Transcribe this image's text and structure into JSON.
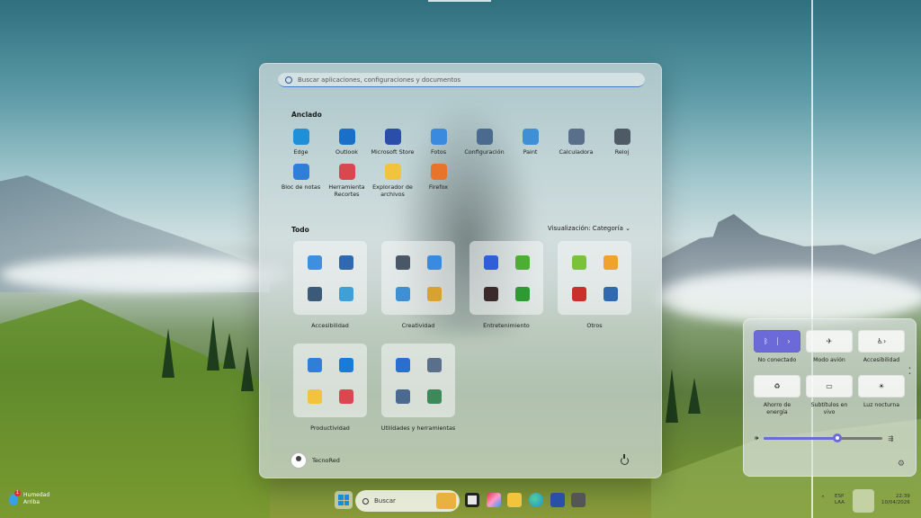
{
  "start_menu": {
    "search_placeholder": "Buscar aplicaciones, configuraciones y documentos",
    "pinned_title": "Anclado",
    "pinned": [
      {
        "label": "Edge",
        "icon": "edge-icon",
        "color": "#1f8fd8"
      },
      {
        "label": "Outlook",
        "icon": "outlook-icon",
        "color": "#1a6fc8"
      },
      {
        "label": "Microsoft Store",
        "icon": "store-icon",
        "color": "#2b4fa8"
      },
      {
        "label": "Fotos",
        "icon": "photos-icon",
        "color": "#3a8be0"
      },
      {
        "label": "Configuración",
        "icon": "gear-icon",
        "color": "#4a6a90"
      },
      {
        "label": "Paint",
        "icon": "paint-icon",
        "color": "#3f8fd5"
      },
      {
        "label": "Calculadora",
        "icon": "calculator-icon",
        "color": "#5a6f8a"
      },
      {
        "label": "Reloj",
        "icon": "clock-icon",
        "color": "#4e5a66"
      },
      {
        "label": "Bloc de notas",
        "icon": "notepad-icon",
        "color": "#2f7fd8"
      },
      {
        "label": "Herramienta Recortes",
        "icon": "snipping-tool-icon",
        "color": "#d9474f"
      },
      {
        "label": "Explorador de archivos",
        "icon": "folder-icon",
        "color": "#f2c33c"
      },
      {
        "label": "Firefox",
        "icon": "firefox-icon",
        "color": "#e8732a"
      }
    ],
    "all_title": "Todo",
    "view_label": "Visualización: Categoría",
    "categories": [
      {
        "label": "Accesibilidad",
        "icons": [
          {
            "name": "voice-access-icon",
            "color": "#3f8fe0"
          },
          {
            "name": "magnifier-icon",
            "color": "#2f6ab0"
          },
          {
            "name": "narrator-icon",
            "color": "#3a5a78"
          },
          {
            "name": "keyboard-icon",
            "color": "#3fa0d8"
          }
        ]
      },
      {
        "label": "Creatividad",
        "icons": [
          {
            "name": "camera-icon",
            "color": "#4a5766"
          },
          {
            "name": "photos-icon",
            "color": "#3a8be0"
          },
          {
            "name": "paint-icon",
            "color": "#3f8fd5"
          },
          {
            "name": "clipchamp-icon",
            "color": "#d9a22f"
          }
        ]
      },
      {
        "label": "Entretenimiento",
        "icons": [
          {
            "name": "headphones-icon",
            "color": "#2e5ed8"
          },
          {
            "name": "nvidia-icon",
            "color": "#4caf34"
          },
          {
            "name": "media-player-icon",
            "color": "#3a2a2a"
          },
          {
            "name": "xbox-icon",
            "color": "#2e9a34"
          }
        ]
      },
      {
        "label": "Otros",
        "icons": [
          {
            "name": "cube-icon",
            "color": "#7ac23a"
          },
          {
            "name": "weather-icon",
            "color": "#f0a22c"
          },
          {
            "name": "filezilla-icon",
            "color": "#c9302c"
          },
          {
            "name": "settings-cluster-icon",
            "color": "#2f6ab0"
          }
        ]
      },
      {
        "label": "Productividad",
        "icons": [
          {
            "name": "notepad-icon",
            "color": "#2f7fd8"
          },
          {
            "name": "remote-desktop-icon",
            "color": "#1a7ad8"
          },
          {
            "name": "folder-icon",
            "color": "#f2c33c"
          },
          {
            "name": "office-icon",
            "color": "#d9474f"
          }
        ]
      },
      {
        "label": "Utilidades y herramientas",
        "icons": [
          {
            "name": "windows-tools-icon",
            "color": "#2a6fd0"
          },
          {
            "name": "calculator-icon",
            "color": "#5a6f8a"
          },
          {
            "name": "gear-icon",
            "color": "#4a6a90"
          },
          {
            "name": "control-panel-icon",
            "color": "#3c8a5a"
          }
        ]
      }
    ],
    "user_name": "TecnoRed"
  },
  "quick_settings": {
    "tiles": [
      {
        "label": "No conectado",
        "icon": "bluetooth-icon",
        "active": true
      },
      {
        "label": "Modo avión",
        "icon": "airplane-icon",
        "active": false
      },
      {
        "label": "Accesibilidad",
        "icon": "accessibility-icon",
        "active": false
      },
      {
        "label": "Ahorro de energía",
        "icon": "energy-saver-icon",
        "active": false
      },
      {
        "label": "Subtítulos en vivo",
        "icon": "captions-icon",
        "active": false
      },
      {
        "label": "Luz nocturna",
        "icon": "night-light-icon",
        "active": false
      }
    ],
    "volume_level": 0.62,
    "accent": "#6b6ad8"
  },
  "taskbar": {
    "weather_title": "Humedad",
    "weather_sub": "Arriba",
    "weather_badge": "1",
    "search_placeholder": "Buscar",
    "lang_top": "ESP",
    "lang_bottom": "LAA",
    "time": "22:39",
    "date": "10/04/2026"
  }
}
